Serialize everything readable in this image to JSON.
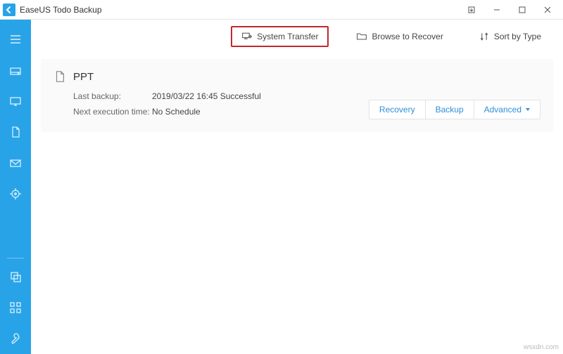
{
  "window": {
    "title": "EaseUS Todo Backup"
  },
  "toolbar": {
    "system_transfer": "System Transfer",
    "browse_to_recover": "Browse to Recover",
    "sort_by_type": "Sort by Type"
  },
  "backup": {
    "name": "PPT",
    "last_backup_label": "Last backup:",
    "last_backup_value": "2019/03/22 16:45 Successful",
    "next_exec_label": "Next execution time:",
    "next_exec_value": "No Schedule",
    "actions": {
      "recovery": "Recovery",
      "backup": "Backup",
      "advanced": "Advanced"
    }
  },
  "watermark": "wsxdn.com"
}
